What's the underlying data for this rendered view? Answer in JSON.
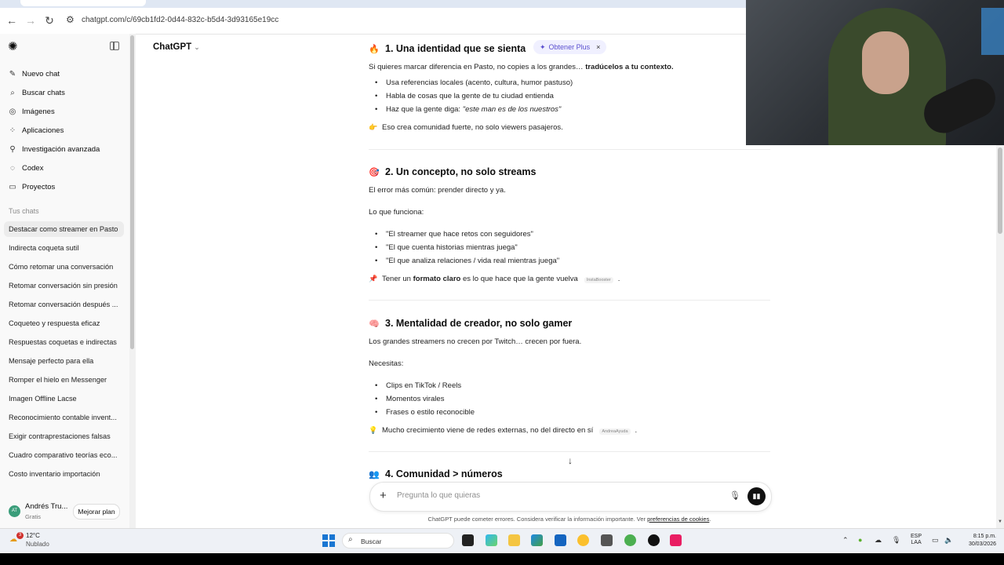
{
  "browser": {
    "url": "chatgpt.com/c/69cb1fd2-0d44-832c-b5d4-3d93165e19cc"
  },
  "sidebar": {
    "nav": [
      {
        "label": "Nuevo chat",
        "icon": "edit-icon"
      },
      {
        "label": "Buscar chats",
        "icon": "search-icon"
      },
      {
        "label": "Imágenes",
        "icon": "image-icon"
      },
      {
        "label": "Aplicaciones",
        "icon": "apps-icon"
      },
      {
        "label": "Investigación avanzada",
        "icon": "research-icon"
      },
      {
        "label": "Codex",
        "icon": "codex-icon"
      },
      {
        "label": "Proyectos",
        "icon": "folder-icon"
      }
    ],
    "section_label": "Tus chats",
    "chats": [
      "Destacar como streamer en Pasto",
      "Indirecta coqueta sutil",
      "Cómo retomar una conversación",
      "Retomar conversación sin presión",
      "Retomar conversación después ...",
      "Coqueteo y respuesta eficaz",
      "Respuestas coquetas e indirectas",
      "Mensaje perfecto para ella",
      "Romper el hielo en Messenger",
      "Imagen Offline Lacse",
      "Reconocimiento contable invent...",
      "Exigir contraprestaciones falsas",
      "Cuadro comparativo teorías eco...",
      "Costo inventario importación"
    ],
    "user": {
      "initials": "AT",
      "name": "Andrés Tru...",
      "plan": "Gratis",
      "upgrade_label": "Mejorar plan"
    }
  },
  "header": {
    "model_label": "ChatGPT",
    "plus_label": "Obtener Plus"
  },
  "content": {
    "s1": {
      "title": "1. Una identidad que se sienta",
      "intro_a": "Si quieres marcar diferencia en Pasto, no copies a los grandes… ",
      "intro_b": "tradúcelos a tu contexto.",
      "bullets": [
        "Usa referencias locales (acento, cultura, humor pastuso)",
        "Habla de cosas que la gente de tu ciudad entienda"
      ],
      "bullet3_a": "Haz que la gente diga: ",
      "bullet3_b": "\"este man es de los nuestros\"",
      "note": "Eso crea comunidad fuerte, no solo viewers pasajeros."
    },
    "s2": {
      "title": "2. Un concepto, no solo streams",
      "p1": "El error más común: prender directo y ya.",
      "p2": "Lo que funciona:",
      "bullets": [
        "\"El streamer que hace retos con seguidores\"",
        "\"El que cuenta historias mientras juega\"",
        "\"El que analiza relaciones / vida real mientras juega\""
      ],
      "note_a": "Tener un ",
      "note_b": "formato claro",
      "note_c": " es lo que hace que la gente vuelva",
      "tag": "InstaBooster",
      "note_end": "."
    },
    "s3": {
      "title": "3. Mentalidad de creador, no solo gamer",
      "p1": "Los grandes streamers no crecen por Twitch… crecen por fuera.",
      "p2": "Necesitas:",
      "bullets": [
        "Clips en TikTok / Reels",
        "Momentos virales",
        "Frases o estilo reconocible"
      ],
      "note": "Mucho crecimiento viene de redes externas, no del directo en sí",
      "tag": "AndreaAyuda",
      "note_end": "."
    },
    "s4": {
      "title": "4. Comunidad > números"
    }
  },
  "composer": {
    "placeholder": "Pregunta lo que quieras"
  },
  "disclaimer": {
    "text": "ChatGPT puede cometer errores. Considera verificar la información importante. Ver ",
    "link": "preferencias de cookies",
    "end": "."
  },
  "taskbar": {
    "weather_temp": "12°C",
    "weather_cond": "Nublado",
    "weather_badge": "3",
    "search_label": "Buscar",
    "lang_1": "ESP",
    "lang_2": "LAA",
    "time": "8:15 p.m.",
    "date": "30/03/2026"
  }
}
